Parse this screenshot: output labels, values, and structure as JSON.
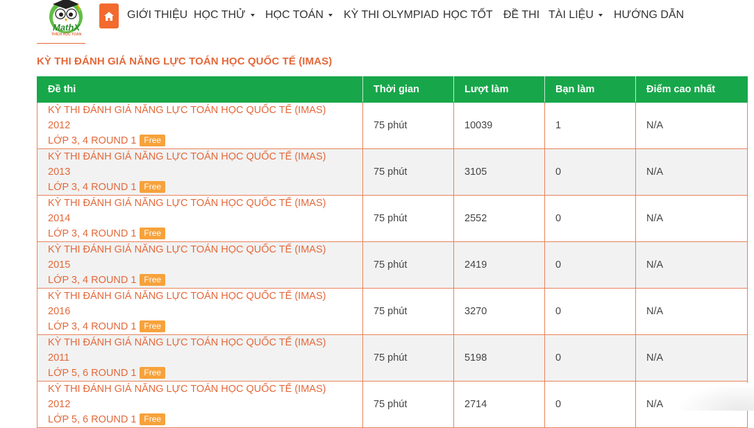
{
  "logo": {
    "text": "MathX",
    "subtext": "THÍCH HỌC TOÁN"
  },
  "nav": {
    "home_icon": "home-icon",
    "items": [
      {
        "label": "GIỚI THIỆU",
        "dropdown": false
      },
      {
        "label": "HỌC THỬ",
        "dropdown": true
      },
      {
        "label": "HỌC TOÁN",
        "dropdown": true
      },
      {
        "label": "KỲ THI OLYMPIAD",
        "dropdown": false
      },
      {
        "label": "HỌC TỐT",
        "dropdown": false
      },
      {
        "label": "ĐỀ THI",
        "dropdown": false
      },
      {
        "label": "TÀI LIỆU",
        "dropdown": true
      },
      {
        "label": "HƯỚNG DẪN",
        "dropdown": false
      }
    ]
  },
  "page_title": "KỲ THI ĐÁNH GIÁ NĂNG LỰC TOÁN HỌC QUỐC TẾ (IMAS)",
  "table": {
    "headers": [
      "Đề thi",
      "Thời gian",
      "Lượt làm",
      "Bạn làm",
      "Điểm cao nhất"
    ],
    "rows": [
      {
        "line1": "KỲ THI ĐÁNH GIÁ NĂNG LỰC TOÁN HỌC QUỐC TẾ (IMAS) 2012",
        "line2": "LỚP 3, 4 ROUND 1",
        "badge": "Free",
        "time": "75 phút",
        "attempts": "10039",
        "yours": "1",
        "best": "N/A"
      },
      {
        "line1": "KỲ THI ĐÁNH GIÁ NĂNG LỰC TOÁN HỌC QUỐC TẾ (IMAS) 2013",
        "line2": "LỚP 3, 4 ROUND 1",
        "badge": "Free",
        "time": "75 phút",
        "attempts": "3105",
        "yours": "0",
        "best": "N/A"
      },
      {
        "line1": "KỲ THI ĐÁNH GIÁ NĂNG LỰC TOÁN HỌC QUỐC TẾ (IMAS) 2014",
        "line2": "LỚP 3, 4 ROUND 1",
        "badge": "Free",
        "time": "75 phút",
        "attempts": "2552",
        "yours": "0",
        "best": "N/A"
      },
      {
        "line1": "KỲ THI ĐÁNH GIÁ NĂNG LỰC TOÁN HỌC QUỐC TẾ (IMAS) 2015",
        "line2": "LỚP 3, 4 ROUND 1",
        "badge": "Free",
        "time": "75 phút",
        "attempts": "2419",
        "yours": "0",
        "best": "N/A"
      },
      {
        "line1": "KỲ THI ĐÁNH GIÁ NĂNG LỰC TOÁN HỌC QUỐC TẾ (IMAS) 2016",
        "line2": "LỚP 3, 4 ROUND 1",
        "badge": "Free",
        "time": "75 phút",
        "attempts": "3270",
        "yours": "0",
        "best": "N/A"
      },
      {
        "line1": "KỲ THI ĐÁNH GIÁ NĂNG LỰC TOÁN HỌC QUỐC TẾ (IMAS) 2011",
        "line2": "LỚP 5, 6 ROUND 1",
        "badge": "Free",
        "time": "75 phút",
        "attempts": "5198",
        "yours": "0",
        "best": "N/A"
      },
      {
        "line1": "KỲ THI ĐÁNH GIÁ NĂNG LỰC TOÁN HỌC QUỐC TẾ (IMAS) 2012",
        "line2": "LỚP 5, 6 ROUND 1",
        "badge": "Free",
        "time": "75 phút",
        "attempts": "2714",
        "yours": "0",
        "best": "N/A"
      }
    ]
  },
  "colors": {
    "brand_orange": "#e4683a",
    "header_green": "#17a74a",
    "badge": "#f7a23b",
    "home_button": "#f26a2e"
  }
}
